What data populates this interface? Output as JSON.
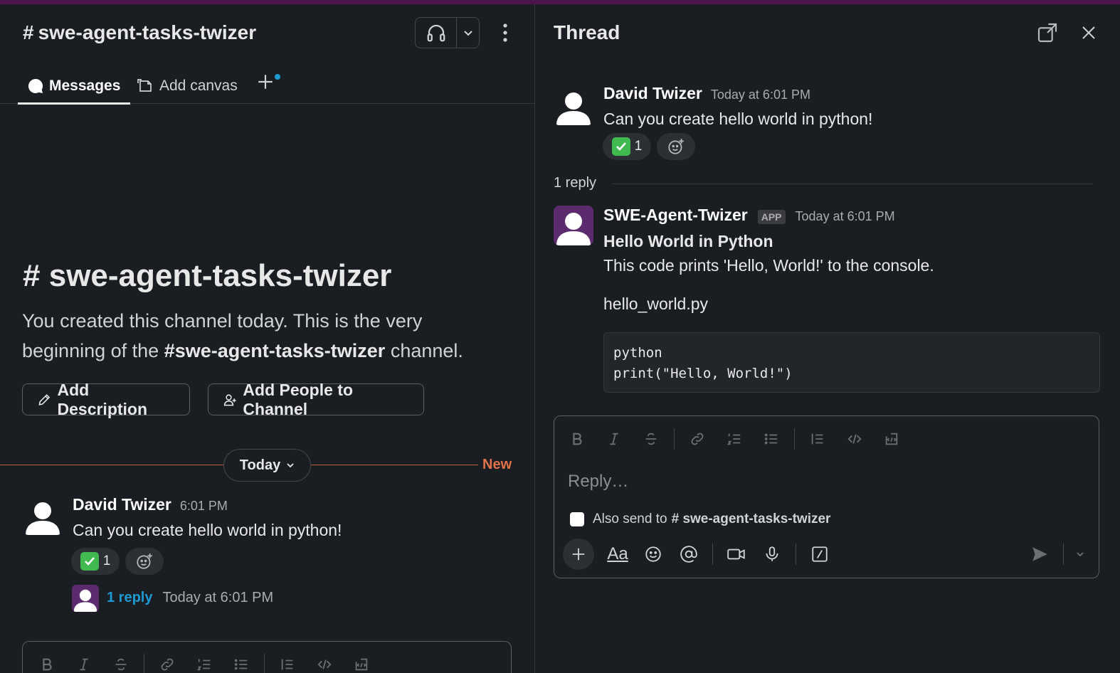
{
  "channel": {
    "hash": "#",
    "name": "swe-agent-tasks-twizer"
  },
  "tabs": {
    "messages": "Messages",
    "add_canvas": "Add canvas"
  },
  "intro": {
    "title_hash": "#",
    "title": "swe-agent-tasks-twizer",
    "line1": "You created this channel today. This is the very",
    "line2_pre": "beginning of the",
    "line2_hash": "#",
    "line2_channel": "swe-agent-tasks-twizer",
    "line2_post": "channel.",
    "add_description": "Add Description",
    "add_people": "Add People to Channel"
  },
  "divider": {
    "today": "Today",
    "new": "New"
  },
  "message": {
    "author": "David Twizer",
    "time": "6:01 PM",
    "text": "Can you create hello world in python!",
    "reaction_count": "1",
    "reply_link": "1 reply",
    "reply_time": "Today at 6:01 PM"
  },
  "thread": {
    "title": "Thread",
    "parent": {
      "author": "David Twizer",
      "time": "Today at 6:01 PM",
      "text": "Can you create hello world in python!",
      "reaction_count": "1"
    },
    "reply_count": "1 reply",
    "reply": {
      "author": "SWE-Agent-Twizer",
      "badge": "APP",
      "time": "Today at 6:01 PM",
      "heading": "Hello World in Python",
      "text": "This code prints 'Hello, World!' to the console.",
      "filename": "hello_world.py",
      "code": "python\nprint(\"Hello, World!\")"
    },
    "composer": {
      "placeholder": "Reply…",
      "also_send_pre": "Also send to",
      "also_send_hash": "#",
      "also_send_channel": "swe-agent-tasks-twizer",
      "format_label": "Aa"
    }
  },
  "colors": {
    "background": "#1a1d21",
    "accent_new": "#e0714a",
    "link": "#1d9bd1",
    "top_bar": "#4a154b"
  }
}
